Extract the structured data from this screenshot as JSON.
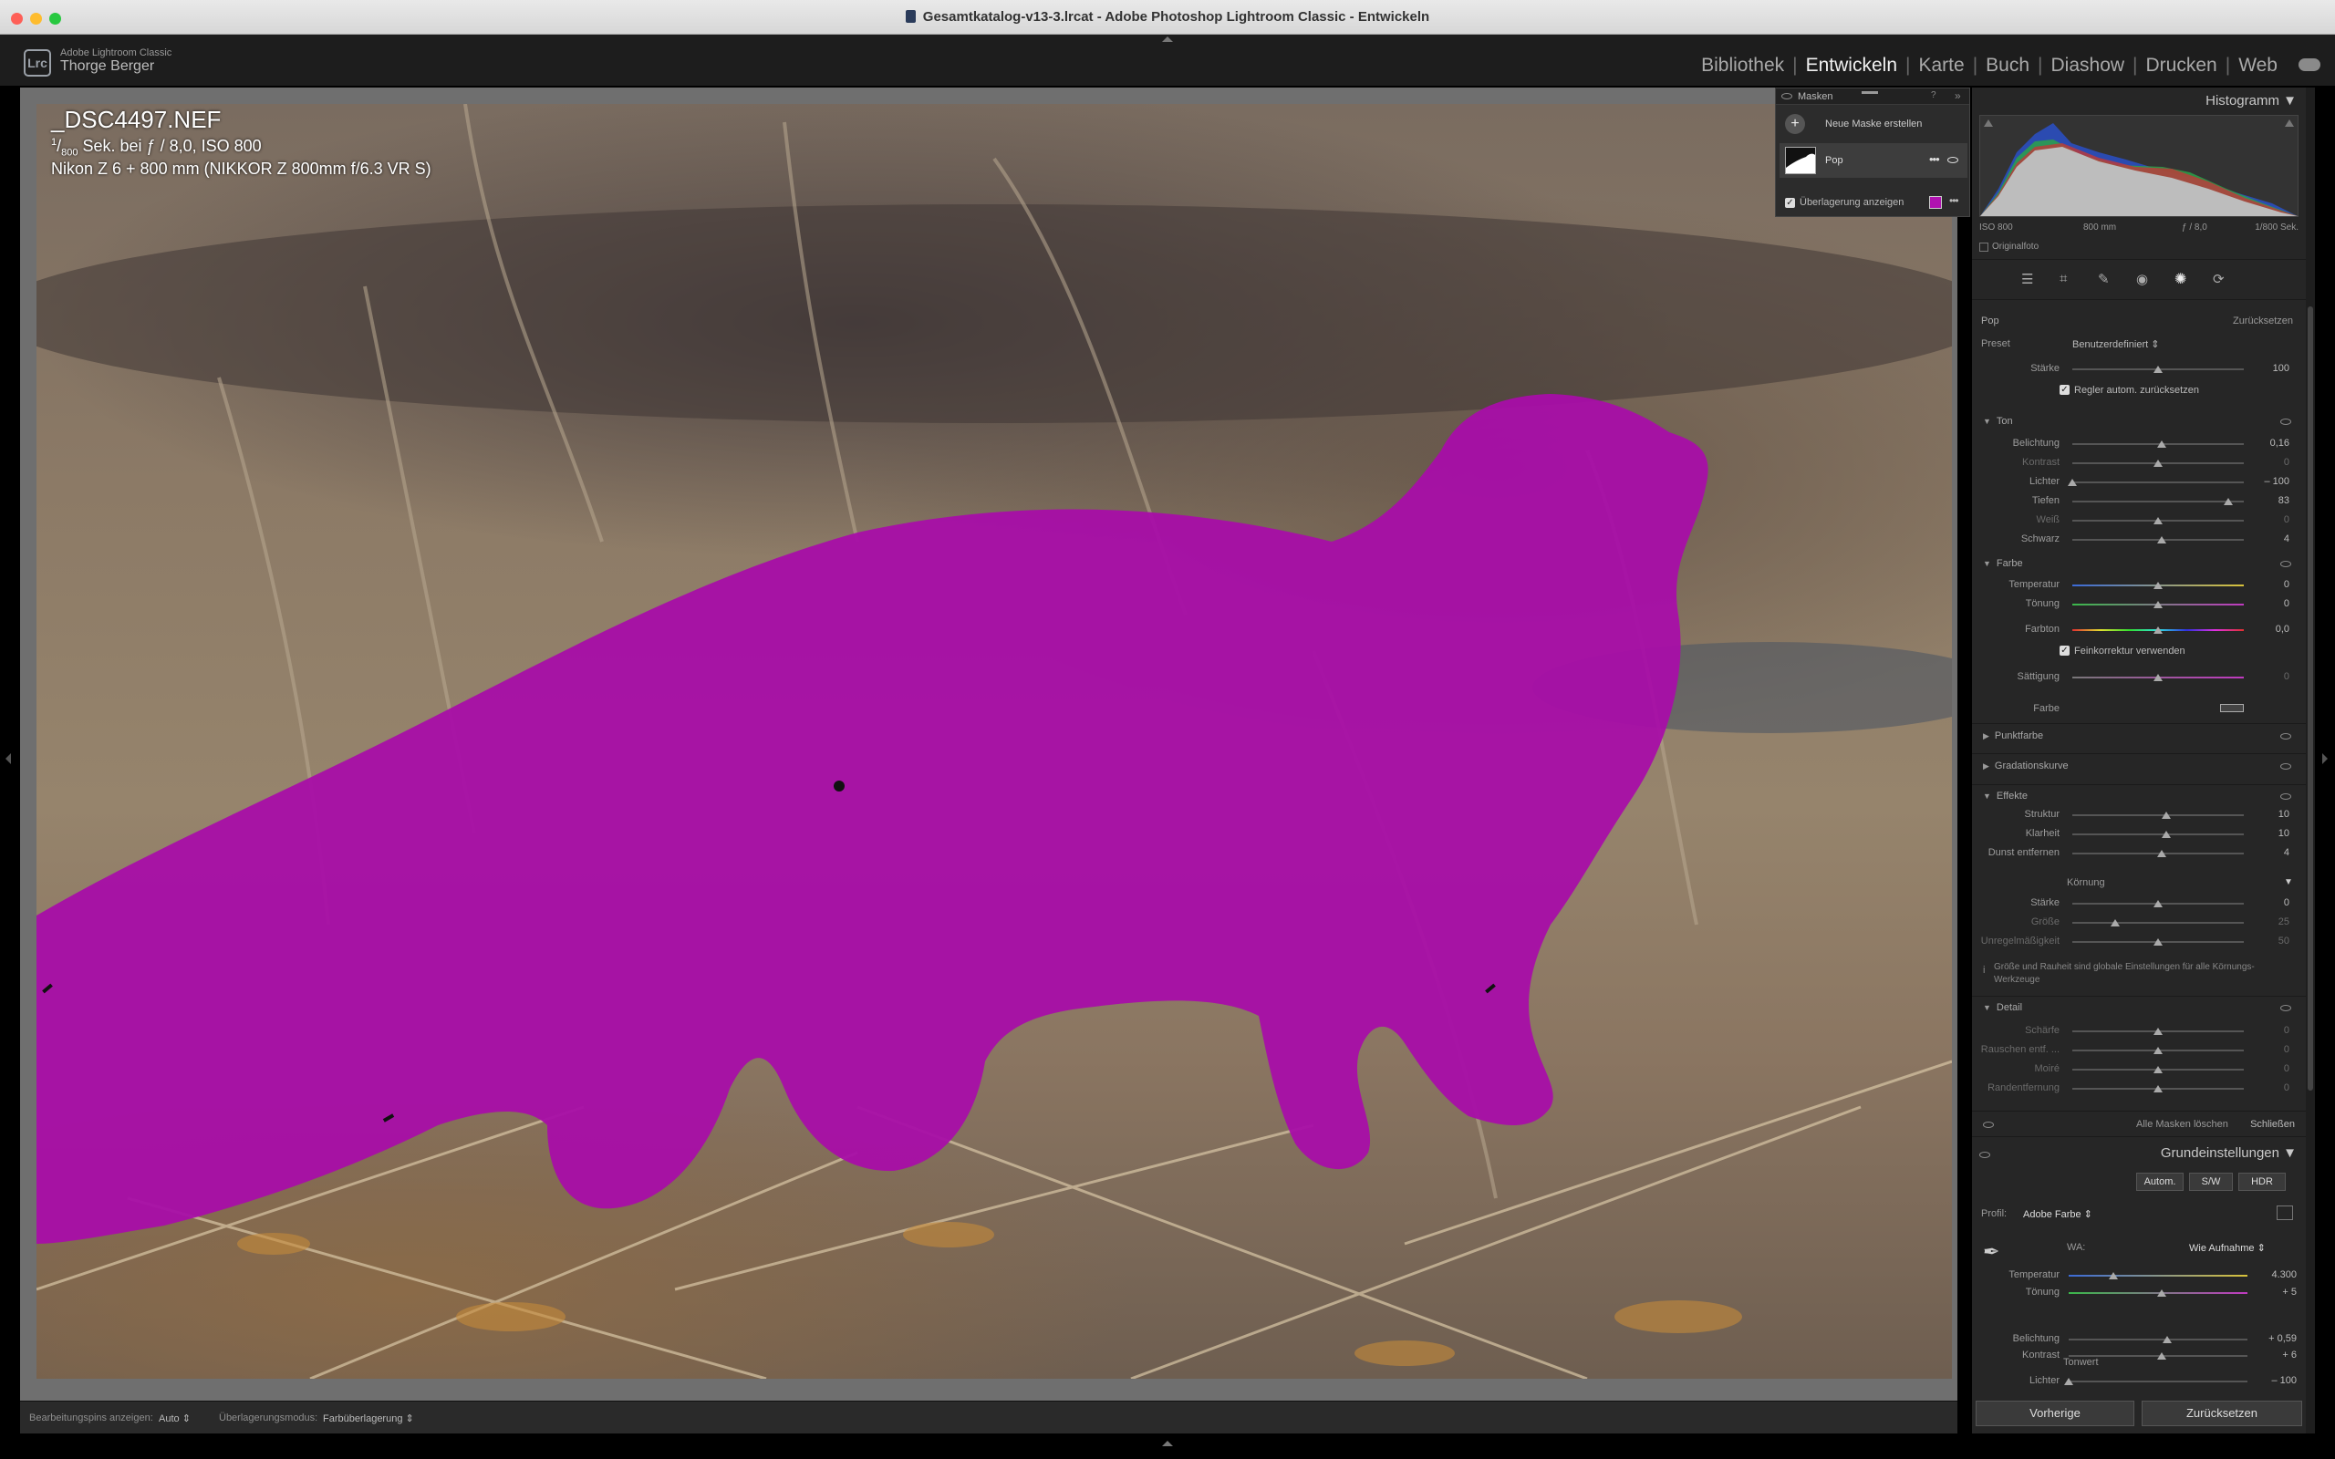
{
  "window": {
    "title": "Gesamtkatalog-v13-3.lrcat - Adobe Photoshop Lightroom Classic - Entwickeln"
  },
  "identity": {
    "logo": "Lrc",
    "app_name": "Adobe Lightroom Classic",
    "user_name": "Thorge Berger"
  },
  "modules": [
    "Bibliothek",
    "Entwickeln",
    "Karte",
    "Buch",
    "Diashow",
    "Drucken",
    "Web"
  ],
  "active_module": "Entwickeln",
  "photo_info": {
    "filename": "_DSC4497.NEF",
    "shutter_num": "1",
    "shutter_den": "800",
    "exposure_rest": "Sek. bei ƒ / 8,0, ISO 800",
    "camera": "Nikon Z 6 + 800 mm (NIKKOR Z 800mm f/6.3 VR S)"
  },
  "masks_panel": {
    "title": "Masken",
    "new_mask": "Neue Maske erstellen",
    "mask_name": "Pop",
    "show_overlay": "Überlagerung anzeigen",
    "overlay_color": "#b012b0"
  },
  "toolbar": {
    "pins_label": "Bearbeitungspins anzeigen:",
    "pins_value": "Auto",
    "overlay_mode_label": "Überlagerungsmodus:",
    "overlay_mode_value": "Farbüberlagerung"
  },
  "histogram": {
    "title": "Histogramm",
    "iso": "ISO 800",
    "focal": "800 mm",
    "aperture": "ƒ / 8,0",
    "shutter": "1/800 Sek.",
    "original_photo": "Originalfoto"
  },
  "mask_adjust": {
    "mask_name": "Pop",
    "reset": "Zurücksetzen",
    "preset_label": "Preset",
    "preset_value": "Benutzerdefiniert",
    "amount_label": "Stärke",
    "amount_value": "100",
    "amount_pos": 0.5,
    "auto_reset": "Regler autom. zurücksetzen"
  },
  "ton": {
    "title": "Ton",
    "rows": [
      {
        "label": "Belichtung",
        "value": "0,16",
        "pos": 0.52,
        "dim": false
      },
      {
        "label": "Kontrast",
        "value": "0",
        "pos": 0.5,
        "dim": true
      },
      {
        "label": "Lichter",
        "value": "– 100",
        "pos": 0.0,
        "dim": false
      },
      {
        "label": "Tiefen",
        "value": "83",
        "pos": 0.91,
        "dim": false
      },
      {
        "label": "Weiß",
        "value": "0",
        "pos": 0.5,
        "dim": true
      },
      {
        "label": "Schwarz",
        "value": "4",
        "pos": 0.52,
        "dim": false
      }
    ]
  },
  "farbe": {
    "title": "Farbe",
    "rows": [
      {
        "label": "Temperatur",
        "value": "0",
        "pos": 0.5
      },
      {
        "label": "Tönung",
        "value": "0",
        "pos": 0.5
      },
      {
        "label": "Farbton",
        "value": "0,0",
        "pos": 0.5
      }
    ],
    "fine_adjust": "Feinkorrektur verwenden",
    "saturation_label": "Sättigung",
    "saturation_value": "0",
    "color_label": "Farbe"
  },
  "collapsed_sections": [
    "Punktfarbe",
    "Gradationskurve"
  ],
  "effekte": {
    "title": "Effekte",
    "rows": [
      {
        "label": "Struktur",
        "value": "10",
        "pos": 0.55,
        "dim": false
      },
      {
        "label": "Klarheit",
        "value": "10",
        "pos": 0.55,
        "dim": false
      },
      {
        "label": "Dunst entfernen",
        "value": "4",
        "pos": 0.52,
        "dim": false
      }
    ],
    "grain_title": "Körnung",
    "grain_rows": [
      {
        "label": "Stärke",
        "value": "0",
        "pos": 0.5,
        "dim": false
      },
      {
        "label": "Größe",
        "value": "25",
        "pos": 0.25,
        "dim": true
      },
      {
        "label": "Unregelmäßigkeit",
        "value": "50",
        "pos": 0.5,
        "dim": true
      }
    ],
    "grain_info": "Größe und Rauheit sind globale Einstellungen für alle Körnungs-Werkzeuge"
  },
  "detail": {
    "title": "Detail",
    "rows": [
      {
        "label": "Schärfe",
        "value": "0",
        "pos": 0.5
      },
      {
        "label": "Rauschen entf. ...",
        "value": "0",
        "pos": 0.5
      },
      {
        "label": "Moiré",
        "value": "0",
        "pos": 0.5
      },
      {
        "label": "Randentfernung",
        "value": "0",
        "pos": 0.5
      }
    ]
  },
  "mask_footer": {
    "delete_all": "Alle Masken löschen",
    "close": "Schließen"
  },
  "basic": {
    "title": "Grundeinstellungen",
    "auto": "Autom.",
    "bw": "S/W",
    "hdr": "HDR",
    "profile_label": "Profil:",
    "profile_value": "Adobe Farbe",
    "wb_label": "WA:",
    "wb_value": "Wie Aufnahme",
    "temp_label": "Temperatur",
    "temp_value": "4.300",
    "temp_pos": 0.25,
    "tint_label": "Tönung",
    "tint_value": "+ 5",
    "tint_pos": 0.52,
    "tone_title": "Tonwert",
    "exposure_label": "Belichtung",
    "exposure_value": "+ 0,59",
    "exposure_pos": 0.55,
    "contrast_label": "Kontrast",
    "contrast_value": "+ 6",
    "contrast_pos": 0.52,
    "highlights_label": "Lichter",
    "highlights_value": "– 100",
    "highlights_pos": 0.0
  },
  "bottom_buttons": {
    "previous": "Vorherige",
    "reset": "Zurücksetzen"
  }
}
